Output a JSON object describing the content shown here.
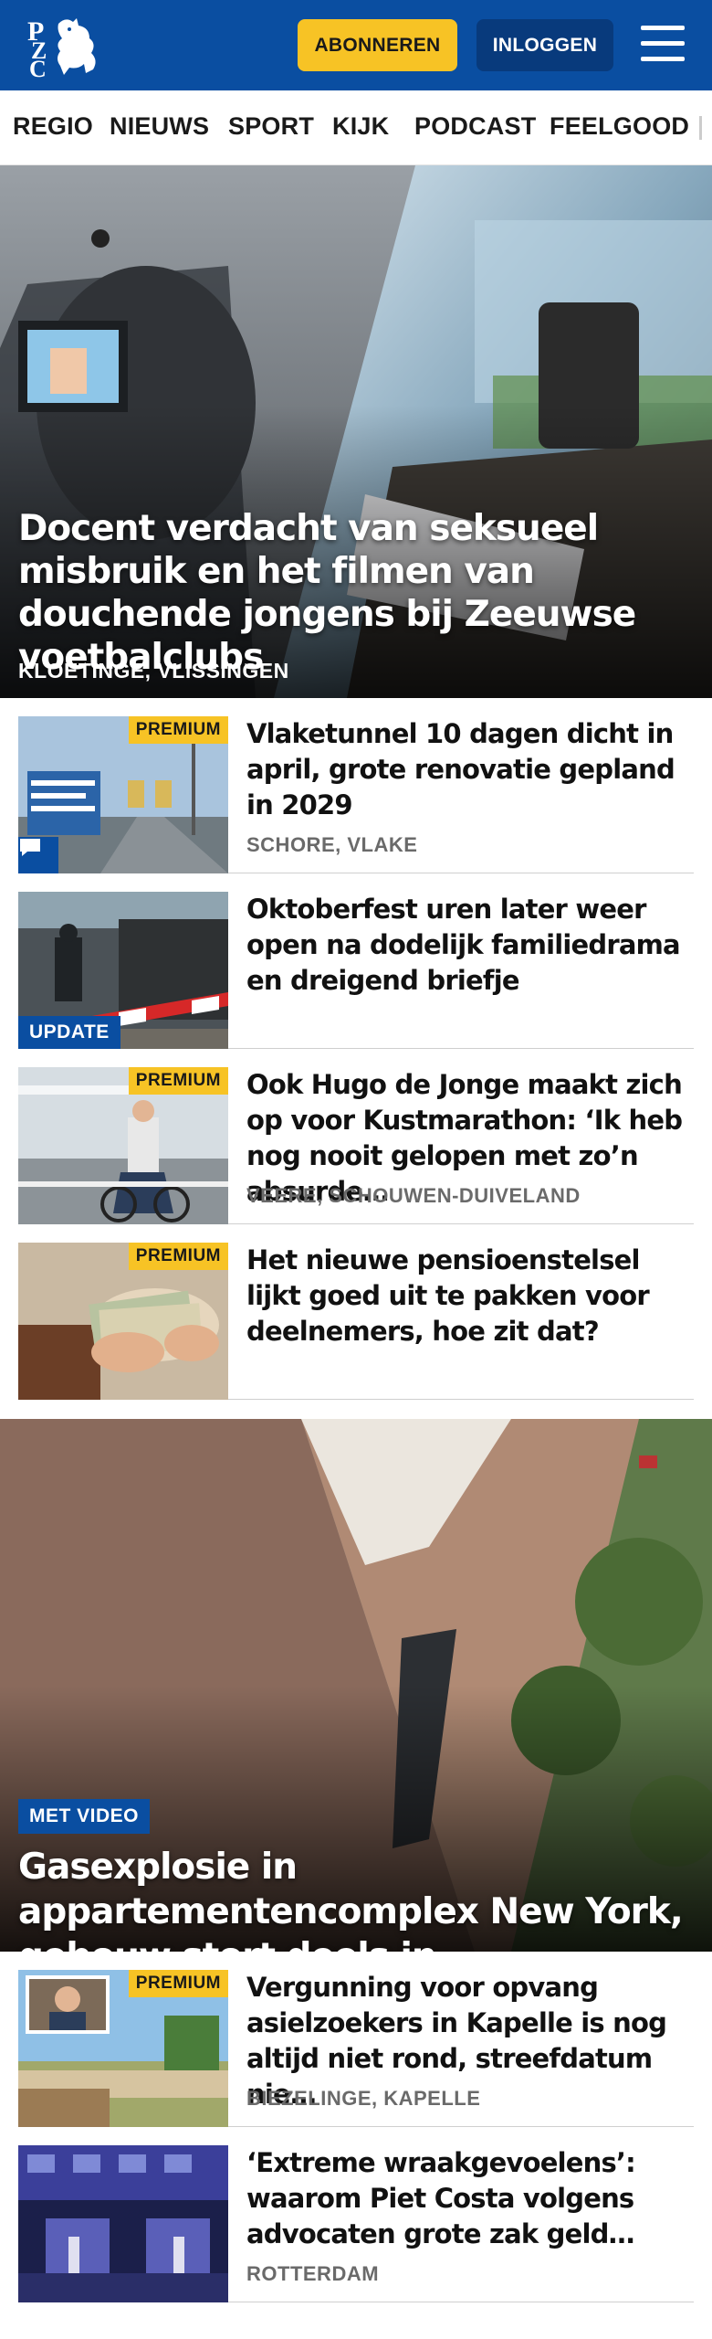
{
  "header": {
    "logo_text": "PZC",
    "subscribe_label": "ABONNEREN",
    "login_label": "INLOGGEN",
    "menu_icon": "hamburger-menu-icon",
    "colors": {
      "brand": "#0a4ea1",
      "accent": "#f7c325"
    }
  },
  "nav": {
    "items": [
      "REGIO",
      "NIEUWS",
      "SPORT",
      "KIJK",
      "PODCAST",
      "FEELGOOD"
    ]
  },
  "hero": {
    "title": "Docent verdacht van seksueel misbruik en het filmen van douchende jongens bij Zeeuwse voetbalclubs",
    "location": "KLOETINGE, VLISSINGEN"
  },
  "articles": [
    {
      "title": "Vlaketunnel 10 dagen dicht in april, grote renovatie gepland in 2029",
      "location": "SCHORE, VLAKE",
      "badge": "PREMIUM",
      "comment_icon": "comment-icon"
    },
    {
      "title": "Oktoberfest uren later weer open na dodelijk familiedrama en dreigend briefje",
      "location": "",
      "badge": "UPDATE"
    },
    {
      "title": "Ook Hugo de Jonge maakt zich op voor Kustmarathon: ‘Ik heb nog nooit gelopen met zo’n absurde…",
      "location": "VEERE, SCHOUWEN-DUIVELAND",
      "badge": "PREMIUM"
    },
    {
      "title": "Het nieuwe pensioenstelsel lijkt goed uit te pakken voor deelnemers, hoe zit dat?",
      "location": "",
      "badge": "PREMIUM"
    }
  ],
  "video_hero": {
    "badge": "MET VIDEO",
    "title": "Gasexplosie in appartementencom­plex New York, gebouw stort deels in"
  },
  "articles2": [
    {
      "title": "Vergunning voor opvang asielzoekers in Kapelle is nog altijd niet rond, streefdatum nie…",
      "location": "BIEZELINGE, KAPELLE",
      "badge": "PREMIUM"
    },
    {
      "title": "‘Extreme wraakgevoelens’: waarom Piet Costa volgens advocaten grote zak geld…",
      "location": "ROTTERDAM",
      "badge": ""
    }
  ]
}
